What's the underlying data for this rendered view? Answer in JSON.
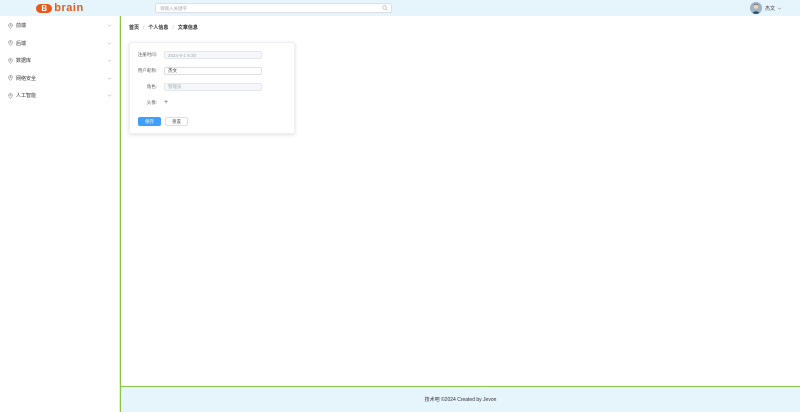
{
  "header": {
    "logo_letter": "B",
    "logo_text": "brain",
    "search_placeholder": "请输入关键字",
    "user_name": "杰文"
  },
  "sidebar": {
    "items": [
      {
        "label": "前端",
        "icon": "location-icon"
      },
      {
        "label": "后端",
        "icon": "location-icon"
      },
      {
        "label": "数据库",
        "icon": "location-icon"
      },
      {
        "label": "网络安全",
        "icon": "location-icon"
      },
      {
        "label": "人工智能",
        "icon": "location-icon"
      }
    ]
  },
  "breadcrumb": [
    "首页",
    "个人信息",
    "文章信息"
  ],
  "profile_form": {
    "register_time_label": "注册时间:",
    "register_time_value": "2024-9-1 8:30",
    "nickname_label": "用户昵称:",
    "nickname_value": "杰文",
    "role_label": "角色:",
    "role_value": "管理员",
    "avatar_label": "头像:",
    "avatar_upload_symbol": "+",
    "save_label": "保存",
    "reset_label": "重置"
  },
  "footer": {
    "text": "技术吧 ©2024 Created by Jevon"
  },
  "colors": {
    "brand": "#e8591a",
    "header_bg": "#e6f4fb",
    "primary": "#409eff",
    "accent_border": "#8bc34a"
  }
}
